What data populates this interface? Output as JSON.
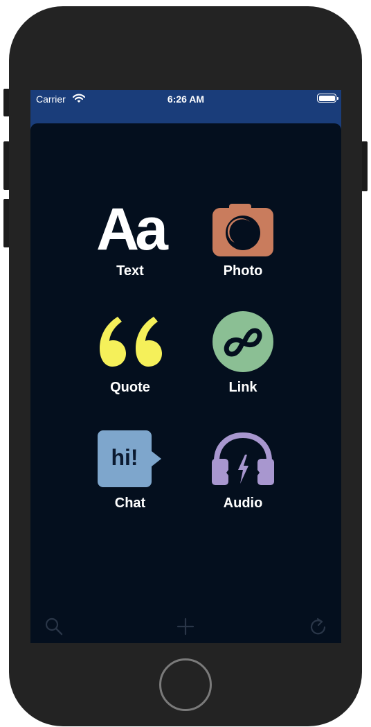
{
  "status_bar": {
    "carrier": "Carrier",
    "time": "6:26 AM"
  },
  "post_types": [
    {
      "label": "Text",
      "icon": "text-aa-icon",
      "color": "#ffffff"
    },
    {
      "label": "Photo",
      "icon": "camera-icon",
      "color": "#c97c5d"
    },
    {
      "label": "Quote",
      "icon": "quote-icon",
      "color": "#f5f05a"
    },
    {
      "label": "Link",
      "icon": "link-icon",
      "color": "#8bbf94"
    },
    {
      "label": "Chat",
      "icon": "chat-hi-icon",
      "color": "#7ea6cc"
    },
    {
      "label": "Audio",
      "icon": "headphones-icon",
      "color": "#a897cf"
    }
  ],
  "text_icon_glyph": "Aa",
  "chat_icon_glyph": "hi!",
  "bottom_bar": {
    "icons": [
      "search-icon",
      "plus-icon",
      "refresh-icon"
    ]
  },
  "colors": {
    "status_bar_bg": "#1a3d7a",
    "sheet_bg": "#040f1e",
    "bottom_icon": "#2a3648"
  }
}
